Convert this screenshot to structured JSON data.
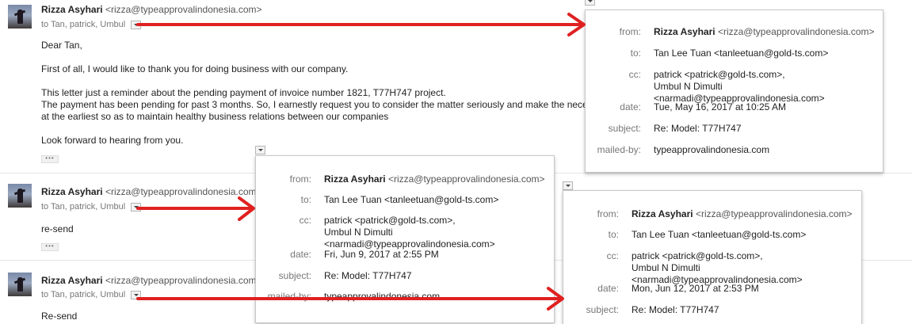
{
  "messages": [
    {
      "sender_name": "Rizza Asyhari",
      "sender_email": "<rizza@typeapprovalindonesia.com>",
      "recipients": "to Tan, patrick, Umbul",
      "body_lines": [
        "Dear Tan,",
        "",
        "First of all, I would like to  thank you for doing business with our company.",
        "",
        "This letter just a reminder about the pending payment of invoice number 1821, T77H747 project.",
        "The payment has been pending for past 3 months. So, I earnestly request you to consider the matter seriously and make the necessary payment",
        "at the earliest so as to maintain healthy business relations between our companies",
        "",
        "Look forward to hearing from you."
      ],
      "ellipsis": "•••"
    },
    {
      "sender_name": "Rizza Asyhari",
      "sender_email": "<rizza@typeapprovalindonesia.com>",
      "recipients": "to Tan, patrick, Umbul",
      "body_lines": [
        "re-send"
      ],
      "ellipsis": "•••"
    },
    {
      "sender_name": "Rizza Asyhari",
      "sender_email": "<rizza@typeapprovalindonesia.com>",
      "recipients": "to Tan, patrick, Umbul",
      "body_lines": [
        "Re-send"
      ]
    }
  ],
  "labels": {
    "from": "from:",
    "to": "to:",
    "cc": "cc:",
    "date": "date:",
    "subject": "subject:",
    "mailed_by": "mailed-by:"
  },
  "popups": [
    {
      "from_name": "Rizza Asyhari",
      "from_email": "<rizza@typeapprovalindonesia.com>",
      "to": "Tan Lee Tuan <tanleetuan@gold-ts.com>",
      "cc_1": "patrick <patrick@gold-ts.com>,",
      "cc_2": "Umbul N Dimulti <narmadi@typeapprovalindonesia.com>",
      "date": "Tue, May 16, 2017 at 10:25 AM",
      "subject": "Re: Model: T77H747",
      "mailed_by": "typeapprovalindonesia.com"
    },
    {
      "from_name": "Rizza Asyhari",
      "from_email": "<rizza@typeapprovalindonesia.com>",
      "to": "Tan Lee Tuan <tanleetuan@gold-ts.com>",
      "cc_1": "patrick <patrick@gold-ts.com>,",
      "cc_2": "Umbul N Dimulti <narmadi@typeapprovalindonesia.com>",
      "date": "Fri, Jun 9, 2017 at 2:55 PM",
      "subject": "Re: Model: T77H747",
      "mailed_by": "typeapprovalindonesia.com"
    },
    {
      "from_name": "Rizza Asyhari",
      "from_email": "<rizza@typeapprovalindonesia.com>",
      "to": "Tan Lee Tuan <tanleetuan@gold-ts.com>",
      "cc_1": "patrick <patrick@gold-ts.com>,",
      "cc_2": "Umbul N Dimulti <narmadi@typeapprovalindonesia.com>",
      "date": "Mon, Jun 12, 2017 at 2:53 PM",
      "subject": "Re: Model: T77H747"
    }
  ],
  "colors": {
    "arrow": "#e02020"
  },
  "icons": [
    "chevron-down-icon",
    "avatar"
  ]
}
